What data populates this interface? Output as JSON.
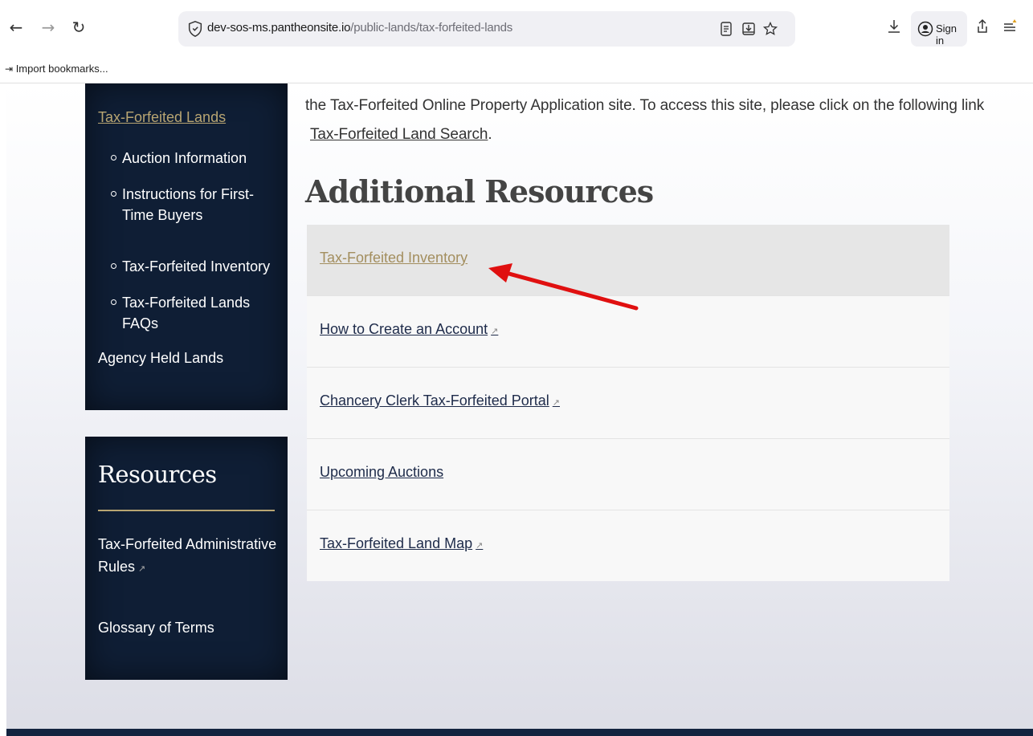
{
  "browser": {
    "url_host": "dev-sos-ms.pantheonsite.io",
    "url_path": "/public-lands/tax-forfeited-lands",
    "sign_in_label": "Sign in",
    "bookmark_label": "Import bookmarks...",
    "icons": [
      "back-icon",
      "forward-icon",
      "reload-icon",
      "shield-icon",
      "reader-view-icon",
      "save-to-pocket-icon",
      "star-icon",
      "download-icon",
      "account-icon",
      "share-icon",
      "menu-icon"
    ]
  },
  "sidebar": {
    "items": [
      {
        "label": "Tax-Forfeited Lands",
        "active": true
      },
      {
        "label": "Agency Held Lands",
        "active": false
      }
    ],
    "sub_items": [
      "Auction Information",
      "Instructions for First-Time Buyers",
      "Tax-Forfeited Inventory",
      "Tax-Forfeited Lands FAQs"
    ]
  },
  "resources_panel": {
    "title": "Resources",
    "links": [
      {
        "label": "Tax-Forfeited Administrative Rules",
        "external": true
      },
      {
        "label": "Glossary of Terms",
        "external": false
      }
    ]
  },
  "main": {
    "intro_text": "the Tax-Forfeited Online Property Application site.  To access this site, please click on the following link",
    "intro_link": "Tax-Forfeited Land Search",
    "intro_suffix": ".",
    "section_title": "Additional Resources",
    "resources": [
      {
        "label": "Tax-Forfeited Inventory",
        "external": false,
        "highlighted": true
      },
      {
        "label": "How to Create an Account",
        "external": true,
        "highlighted": false
      },
      {
        "label": "Chancery Clerk Tax-Forfeited Portal",
        "external": true,
        "highlighted": false
      },
      {
        "label": "Upcoming Auctions",
        "external": false,
        "highlighted": false
      },
      {
        "label": "Tax-Forfeited Land Map",
        "external": true,
        "highlighted": false
      }
    ]
  },
  "colors": {
    "panel_bg": "#0f1e35",
    "accent_gold": "#b8a572",
    "link_navy": "#1e2b4a",
    "annotation_arrow": "#e01010"
  }
}
